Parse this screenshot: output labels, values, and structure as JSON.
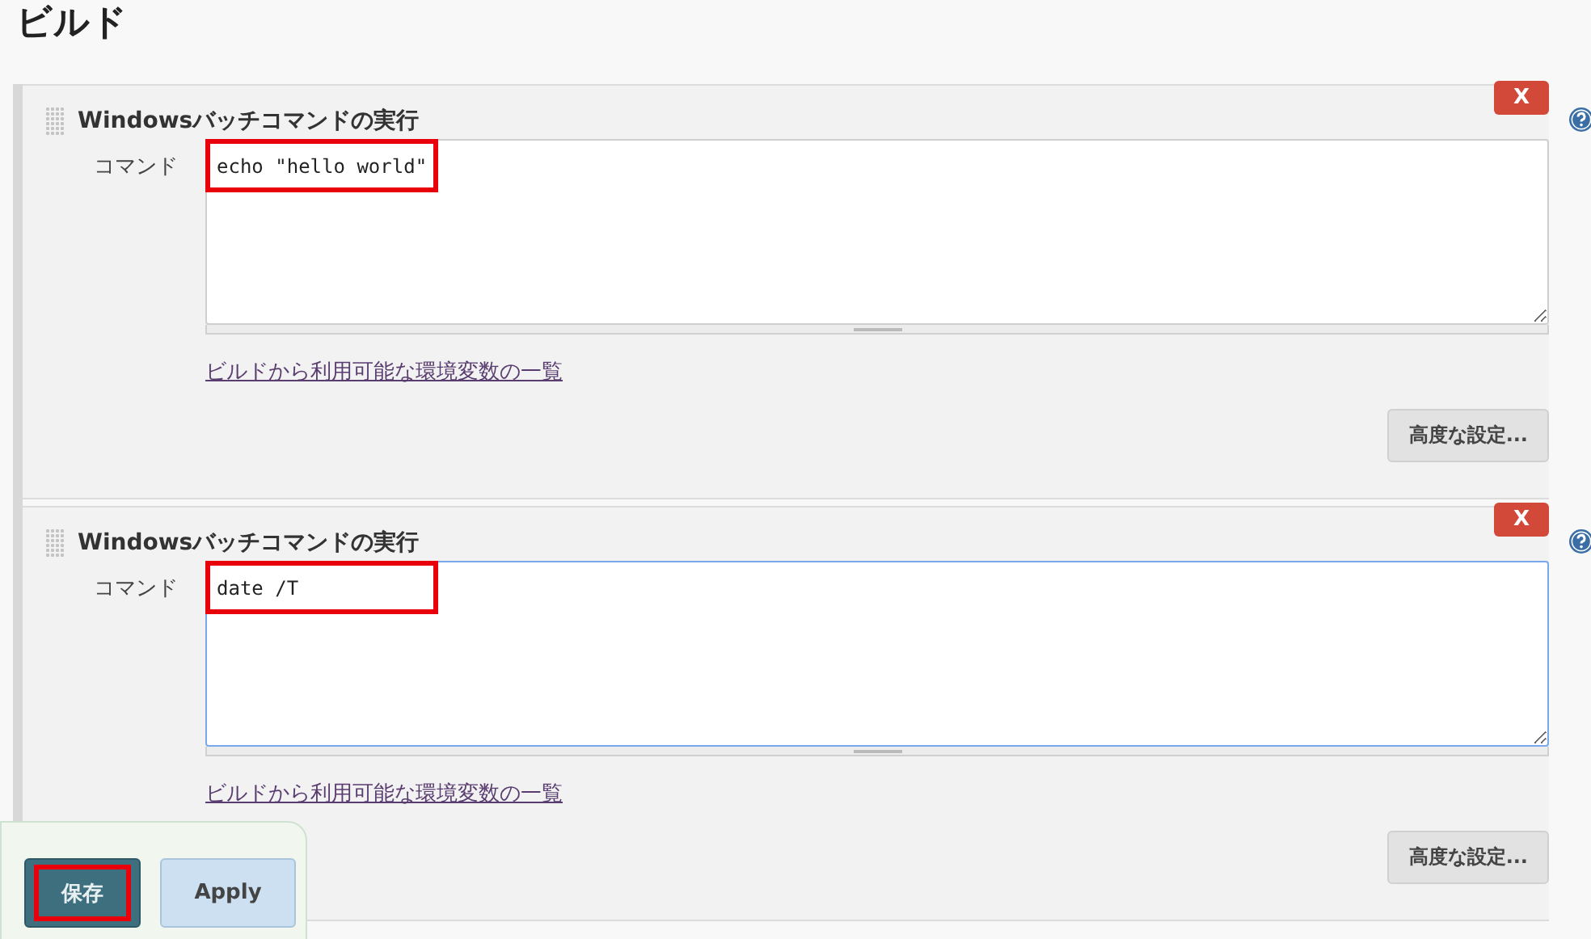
{
  "heading": "ビルド",
  "steps": [
    {
      "title": "Windowsバッチコマンドの実行",
      "delete": "X",
      "label": "コマンド",
      "command": "echo \"hello world\"",
      "focused": false,
      "highlighted": true,
      "link": "ビルドから利用可能な環境変数の一覧",
      "advanced": "高度な設定..."
    },
    {
      "title": "Windowsバッチコマンドの実行",
      "delete": "X",
      "label": "コマンド",
      "command": "date /T",
      "focused": true,
      "highlighted": true,
      "link": "ビルドから利用可能な環境変数の一覧",
      "advanced": "高度な設定..."
    }
  ],
  "bottom_bar": {
    "save": {
      "label": "保存",
      "highlighted": true
    },
    "apply": {
      "label": "Apply"
    }
  }
}
